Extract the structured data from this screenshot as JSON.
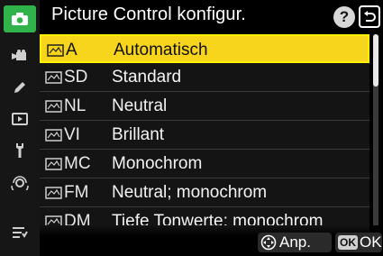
{
  "header": {
    "title": "Picture Control konfigur.",
    "help_label": "?",
    "back_label": "back"
  },
  "sidebar": {
    "items": [
      {
        "icon": "camera-icon",
        "active": true
      },
      {
        "icon": "movie-camera-icon",
        "active": false
      },
      {
        "icon": "pencil-icon",
        "active": false
      },
      {
        "icon": "playback-icon",
        "active": false
      },
      {
        "icon": "wrench-icon",
        "active": false
      },
      {
        "icon": "network-icon",
        "active": false
      },
      {
        "icon": "my-menu-icon",
        "active": false
      }
    ]
  },
  "list": {
    "items": [
      {
        "code": "A",
        "label": "Automatisch",
        "selected": true
      },
      {
        "code": "SD",
        "label": "Standard",
        "selected": false
      },
      {
        "code": "NL",
        "label": "Neutral",
        "selected": false
      },
      {
        "code": "VI",
        "label": "Brillant",
        "selected": false
      },
      {
        "code": "MC",
        "label": "Monochrom",
        "selected": false
      },
      {
        "code": "FM",
        "label": "Neutral; monochrom",
        "selected": false
      },
      {
        "code": "DM",
        "label": "Tiefe Tonwerte; monochrom",
        "selected": false
      }
    ]
  },
  "footer": {
    "adjust_label": "Anp.",
    "ok_badge": "OK",
    "ok_label": "OK"
  },
  "colors": {
    "accent": "#2fb34a",
    "selection": "#f7d51d"
  }
}
